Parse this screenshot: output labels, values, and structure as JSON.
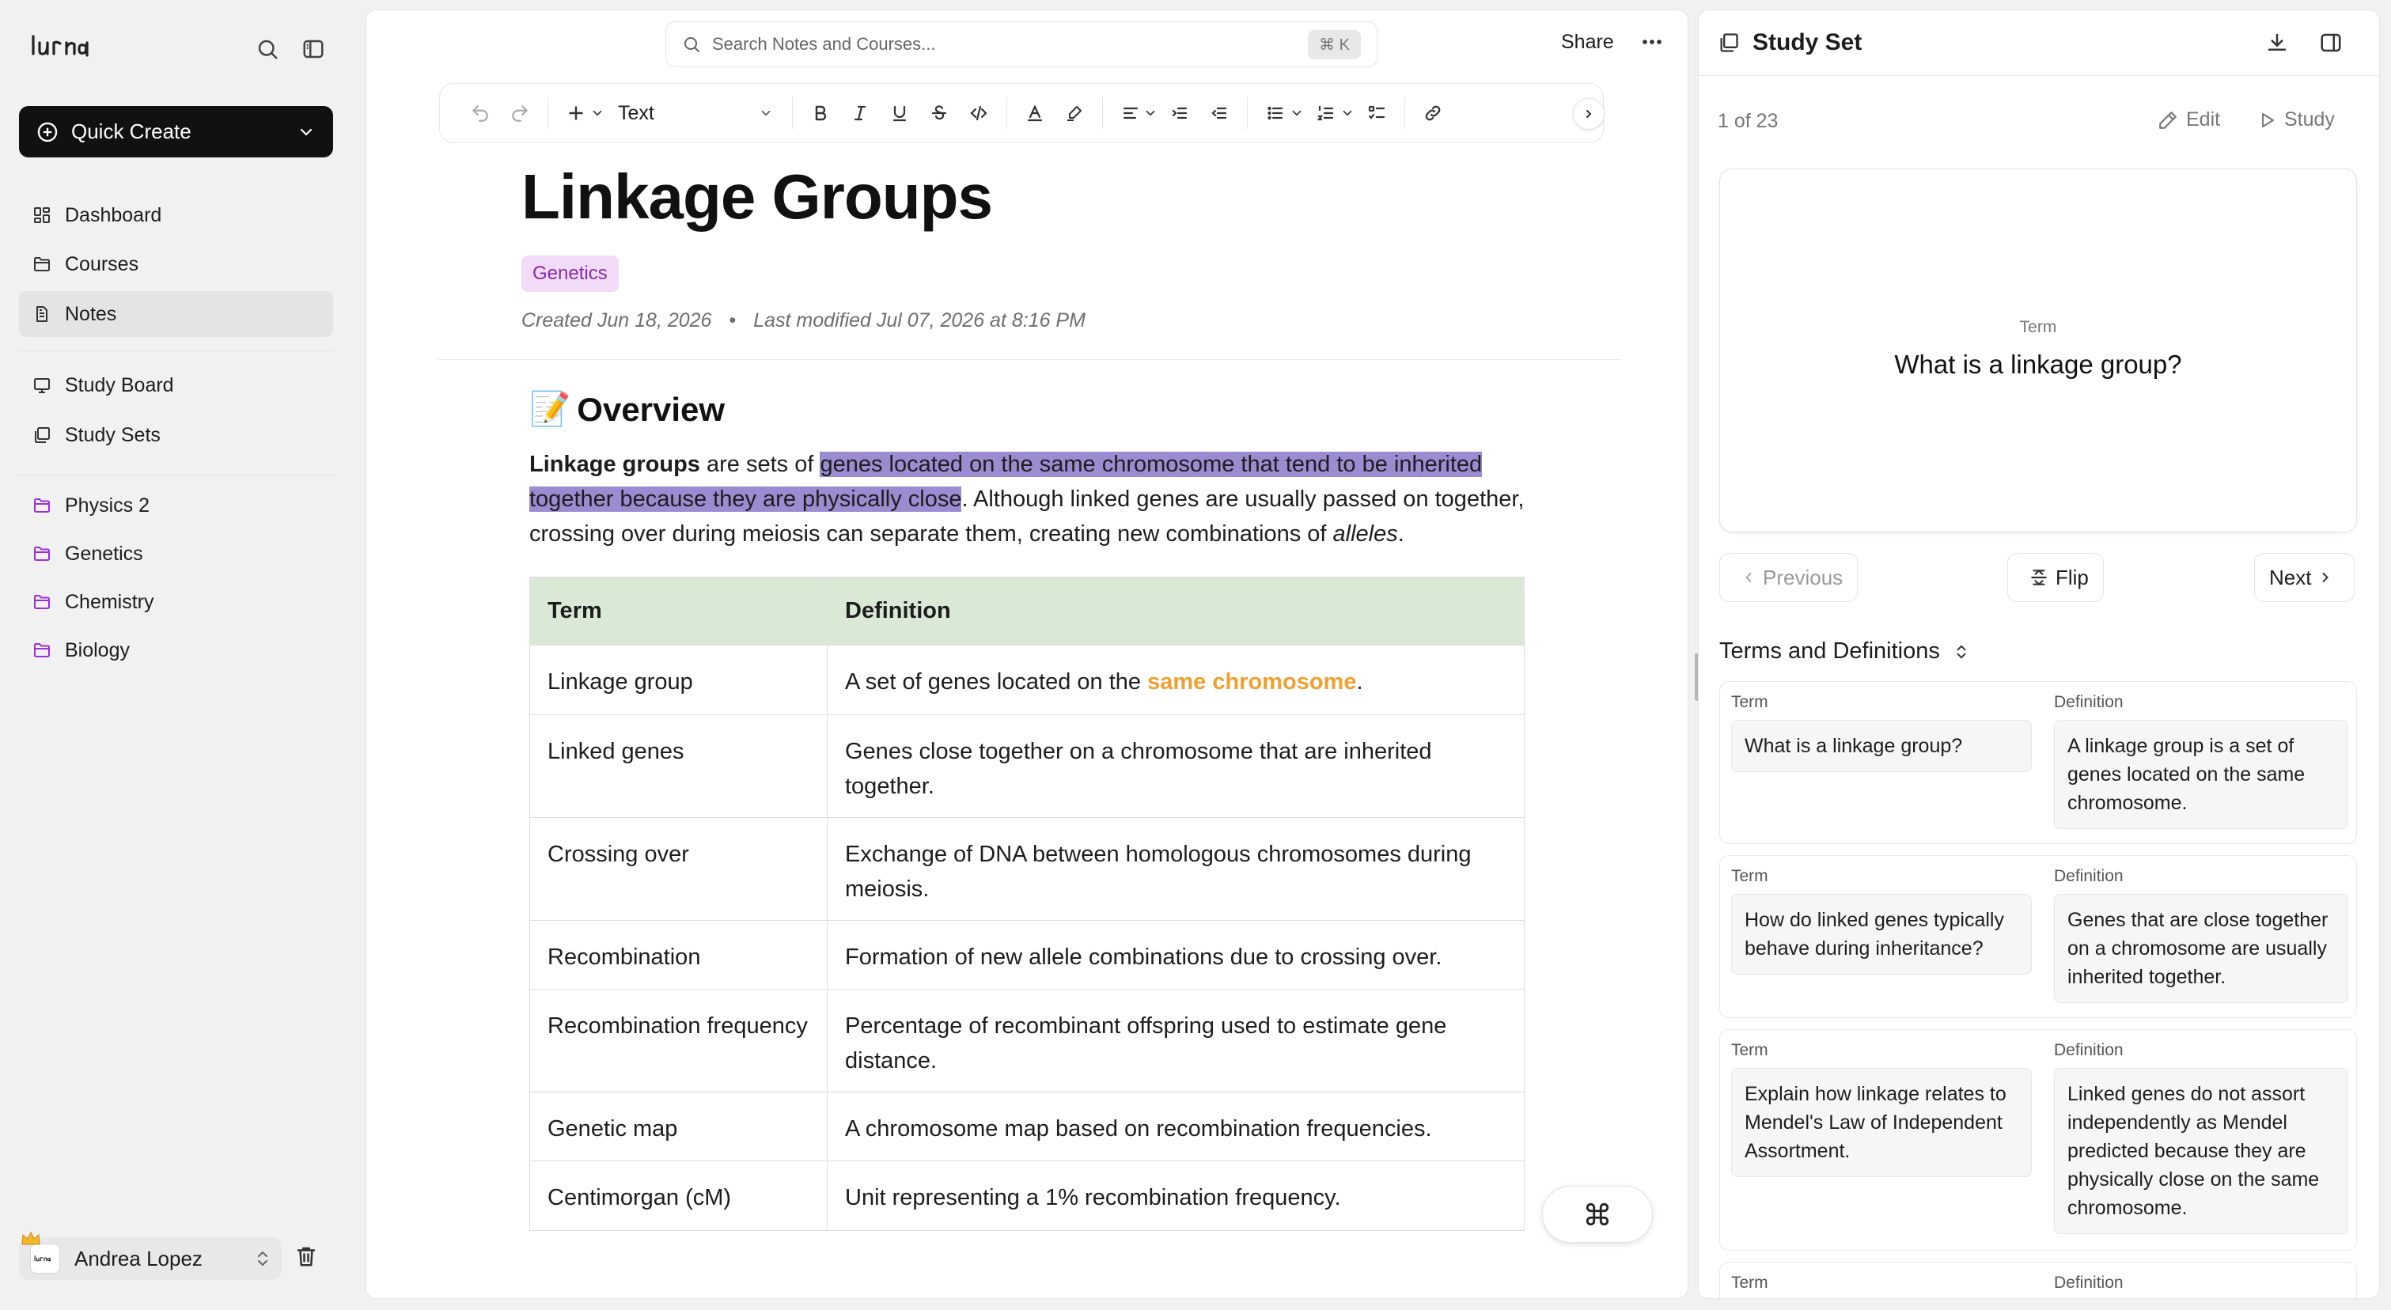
{
  "sidebar": {
    "logo_text": "lurna",
    "quick_create": "Quick Create",
    "nav": [
      {
        "label": "Dashboard",
        "icon": "dashboard-icon"
      },
      {
        "label": "Courses",
        "icon": "folder-icon"
      },
      {
        "label": "Notes",
        "icon": "document-icon"
      }
    ],
    "nav2": [
      {
        "label": "Study Board",
        "icon": "board-icon"
      },
      {
        "label": "Study Sets",
        "icon": "cards-icon"
      }
    ],
    "folders": [
      {
        "label": "Physics 2"
      },
      {
        "label": "Genetics"
      },
      {
        "label": "Chemistry"
      },
      {
        "label": "Biology"
      }
    ],
    "user_name": "Andrea Lopez",
    "folder_color": "#9b30d9"
  },
  "header": {
    "search_placeholder": "Search Notes and Courses...",
    "shortcut": "⌘ K",
    "share": "Share"
  },
  "toolbar": {
    "block_type": "Text"
  },
  "note": {
    "title": "Linkage Groups",
    "tag": "Genetics",
    "created": "Created Jun 18, 2026",
    "separator": "•",
    "modified": "Last modified Jul 07, 2026 at 8:16 PM",
    "heading_emoji": "📝",
    "heading": "Overview",
    "para": {
      "bold": "Linkage groups",
      "t1": " are sets of ",
      "highlight": "genes located on the same chromosome that tend to be inherited together because they are physically close",
      "t2": ". Although linked genes are usually passed on together, crossing over during meiosis can separate them, creating new combinations of ",
      "italic": "alleles",
      "t3": "."
    },
    "table": {
      "headers": [
        "Term",
        "Definition"
      ],
      "rows": [
        {
          "term": "Linkage group",
          "def_pre": "A set of genes located on the ",
          "def_em": "same chromosome",
          "def_post": "."
        },
        {
          "term": "Linked genes",
          "def": "Genes close together on a chromosome that are inherited together."
        },
        {
          "term": "Crossing over",
          "def": "Exchange of DNA between homologous chromosomes during meiosis."
        },
        {
          "term": "Recombination",
          "def": "Formation of new allele combinations due to crossing over."
        },
        {
          "term": "Recombination frequency",
          "def": "Percentage of recombinant offspring used to estimate gene distance."
        },
        {
          "term": "Genetic map",
          "def": "A chromosome map based on recombination frequencies."
        },
        {
          "term": "Centimorgan (cM)",
          "def": "Unit representing a 1% recombination frequency."
        }
      ]
    },
    "highlight_color": "#9b8bd0",
    "accent_orange": "#f0a030",
    "table_header_bg": "#dae9d5"
  },
  "study_set": {
    "title": "Study Set",
    "counter": "1 of 23",
    "edit": "Edit",
    "study": "Study",
    "card_label": "Term",
    "card_question": "What is a linkage group?",
    "prev": "Previous",
    "flip": "Flip",
    "next": "Next",
    "list_title": "Terms and Definitions",
    "term_label": "Term",
    "def_label": "Definition",
    "items": [
      {
        "term": "What is a linkage group?",
        "def": "A linkage group is a set of genes located on the same chromosome."
      },
      {
        "term": "How do linked genes typically behave during inheritance?",
        "def": "Genes that are close together on a chromosome are usually inherited together."
      },
      {
        "term": "Explain how linkage relates to Mendel's Law of Independent Assortment.",
        "def": "Linked genes do not assort independently as Mendel predicted because they are physically close on the same chromosome."
      }
    ]
  }
}
